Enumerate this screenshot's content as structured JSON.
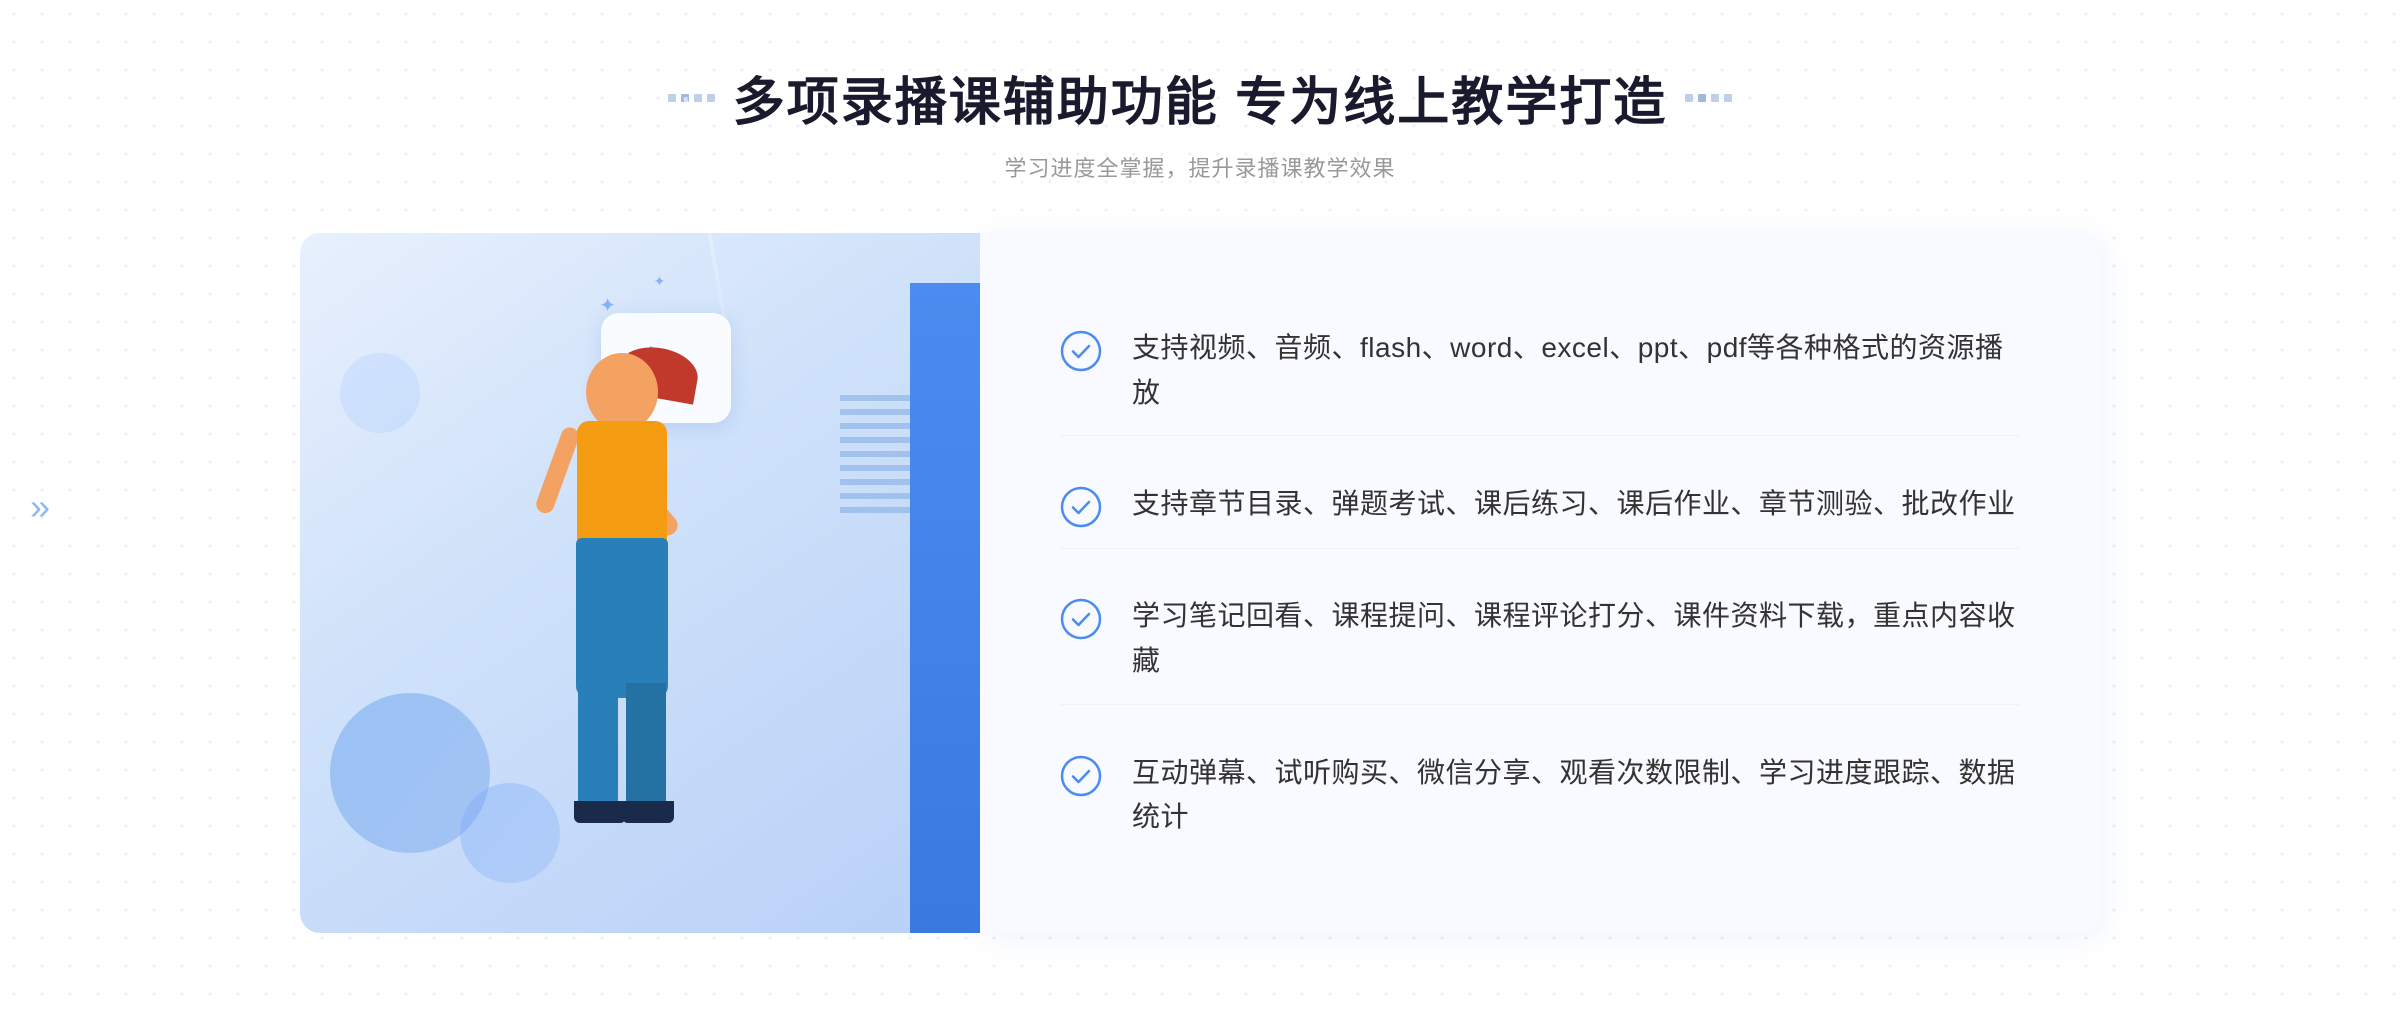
{
  "page": {
    "background": "#ffffff"
  },
  "header": {
    "title": "多项录播课辅助功能 专为线上教学打造",
    "subtitle": "学习进度全掌握，提升录播课教学效果"
  },
  "features": [
    {
      "id": 1,
      "text": "支持视频、音频、flash、word、excel、ppt、pdf等各种格式的资源播放"
    },
    {
      "id": 2,
      "text": "支持章节目录、弹题考试、课后练习、课后作业、章节测验、批改作业"
    },
    {
      "id": 3,
      "text": "学习笔记回看、课程提问、课程评论打分、课件资料下载，重点内容收藏"
    },
    {
      "id": 4,
      "text": "互动弹幕、试听购买、微信分享、观看次数限制、学习进度跟踪、数据统计"
    }
  ],
  "decorations": {
    "left_arrows": "»",
    "check_color": "#4a8cef",
    "title_dot_color": "#b0c8e8"
  }
}
